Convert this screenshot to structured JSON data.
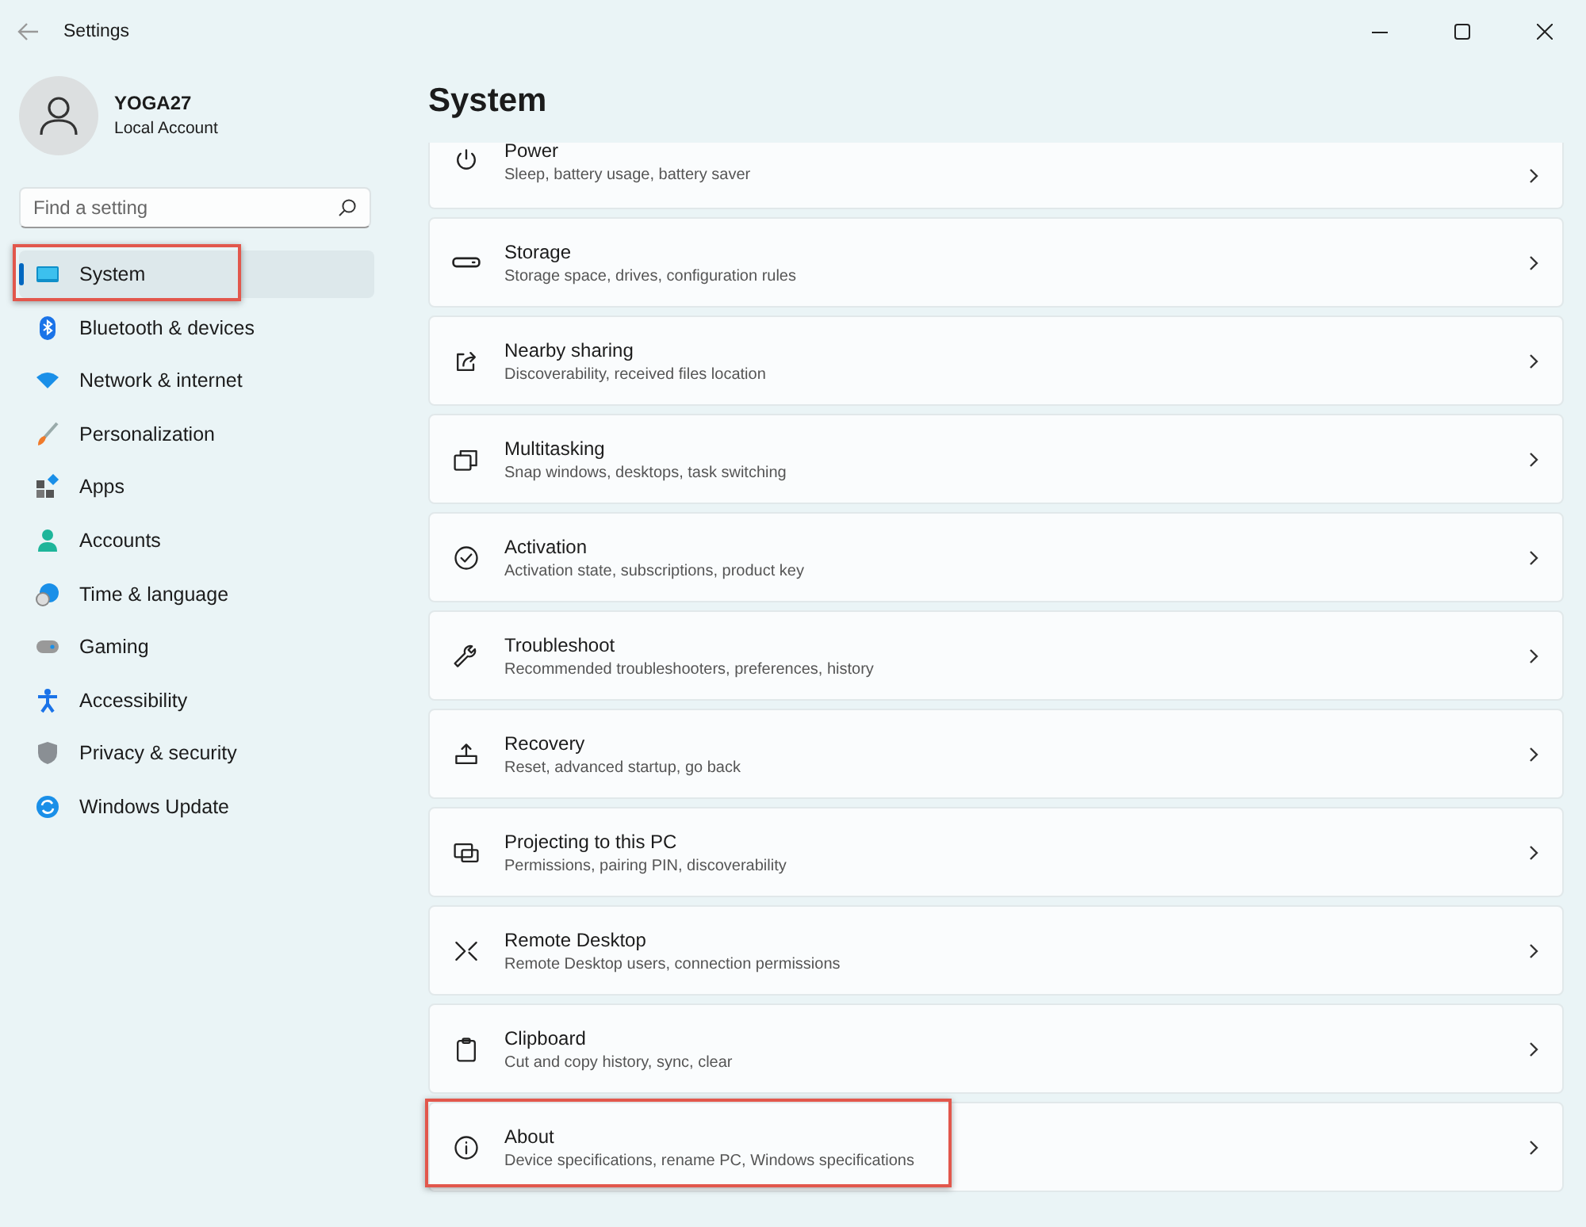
{
  "window": {
    "title": "Settings"
  },
  "account": {
    "name": "YOGA27",
    "type": "Local Account"
  },
  "search": {
    "placeholder": "Find a setting"
  },
  "sidebar": {
    "items": [
      {
        "label": "System",
        "selected": true,
        "highlighted": true
      },
      {
        "label": "Bluetooth & devices",
        "selected": false,
        "highlighted": false
      },
      {
        "label": "Network & internet",
        "selected": false,
        "highlighted": false
      },
      {
        "label": "Personalization",
        "selected": false,
        "highlighted": false
      },
      {
        "label": "Apps",
        "selected": false,
        "highlighted": false
      },
      {
        "label": "Accounts",
        "selected": false,
        "highlighted": false
      },
      {
        "label": "Time & language",
        "selected": false,
        "highlighted": false
      },
      {
        "label": "Gaming",
        "selected": false,
        "highlighted": false
      },
      {
        "label": "Accessibility",
        "selected": false,
        "highlighted": false
      },
      {
        "label": "Privacy & security",
        "selected": false,
        "highlighted": false
      },
      {
        "label": "Windows Update",
        "selected": false,
        "highlighted": false
      }
    ]
  },
  "page": {
    "title": "System"
  },
  "settings": [
    {
      "title": "Power",
      "description": "Sleep, battery usage, battery saver",
      "highlighted": false
    },
    {
      "title": "Storage",
      "description": "Storage space, drives, configuration rules",
      "highlighted": false
    },
    {
      "title": "Nearby sharing",
      "description": "Discoverability, received files location",
      "highlighted": false
    },
    {
      "title": "Multitasking",
      "description": "Snap windows, desktops, task switching",
      "highlighted": false
    },
    {
      "title": "Activation",
      "description": "Activation state, subscriptions, product key",
      "highlighted": false
    },
    {
      "title": "Troubleshoot",
      "description": "Recommended troubleshooters, preferences, history",
      "highlighted": false
    },
    {
      "title": "Recovery",
      "description": "Reset, advanced startup, go back",
      "highlighted": false
    },
    {
      "title": "Projecting to this PC",
      "description": "Permissions, pairing PIN, discoverability",
      "highlighted": false
    },
    {
      "title": "Remote Desktop",
      "description": "Remote Desktop users, connection permissions",
      "highlighted": false
    },
    {
      "title": "Clipboard",
      "description": "Cut and copy history, sync, clear",
      "highlighted": false
    },
    {
      "title": "About",
      "description": "Device specifications, rename PC, Windows specifications",
      "highlighted": true
    }
  ]
}
